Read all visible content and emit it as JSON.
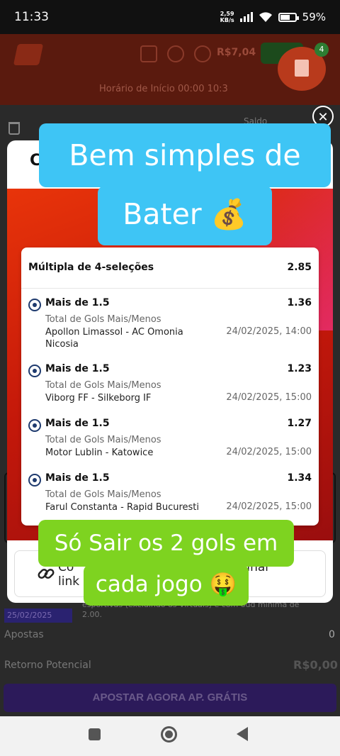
{
  "status_bar": {
    "time": "11:33",
    "net_speed": "2,59",
    "net_unit": "KB/s",
    "battery": "59%",
    "battery_level": 0.59
  },
  "app_header": {
    "balance": "R$7,04",
    "notification_count": "4",
    "promo_text": "Horário de Início 00:00 10:3"
  },
  "slip": {
    "saldo_label": "Saldo",
    "promo_date": "25/02/2025",
    "promo_desc": "esportivas (excluindo os Virtuais) e com odd mínima de 2.00.",
    "apostas_label": "Apostas",
    "apostas_value": "0",
    "retorno_label": "Retorno Potencial",
    "retorno_value": "R$0,00",
    "apostar_label": "APOSTAR AGORA AP. GRÁTIS"
  },
  "modal": {
    "title": "C",
    "close": "✕"
  },
  "ticket": {
    "title": "Múltipla de 4-seleções",
    "total_odd": "2.85",
    "selections": [
      {
        "pick": "Mais de 1.5",
        "odd": "1.36",
        "market": "Total de Gols Mais/Menos",
        "match": "Apollon Limassol - AC Omonia Nicosia",
        "date": "24/02/2025, 14:00"
      },
      {
        "pick": "Mais de 1.5",
        "odd": "1.23",
        "market": "Total de Gols Mais/Menos",
        "match": "Viborg FF - Silkeborg IF",
        "date": "24/02/2025, 15:00"
      },
      {
        "pick": "Mais de 1.5",
        "odd": "1.27",
        "market": "Total de Gols Mais/Menos",
        "match": "Motor Lublin - Katowice",
        "date": "24/02/2025, 15:00"
      },
      {
        "pick": "Mais de 1.5",
        "odd": "1.34",
        "market": "Total de Gols Mais/Menos",
        "match": "Farul Constanta - Rapid Bucuresti",
        "date": "24/02/2025, 15:00"
      }
    ]
  },
  "share": {
    "copy_link_part1": "Co",
    "copy_link_part2": "link",
    "share_part": "rtilhar"
  },
  "captions": {
    "top_line1": "Bem simples de",
    "top_line2": "Bater 💰",
    "bottom_line1": "Só Sair os 2 gols em",
    "bottom_line2": "cada jogo 🤑"
  },
  "colors": {
    "caption_blue": "#3ec5f5",
    "caption_green": "#7ed320",
    "banner_orange": "#e8340a"
  }
}
